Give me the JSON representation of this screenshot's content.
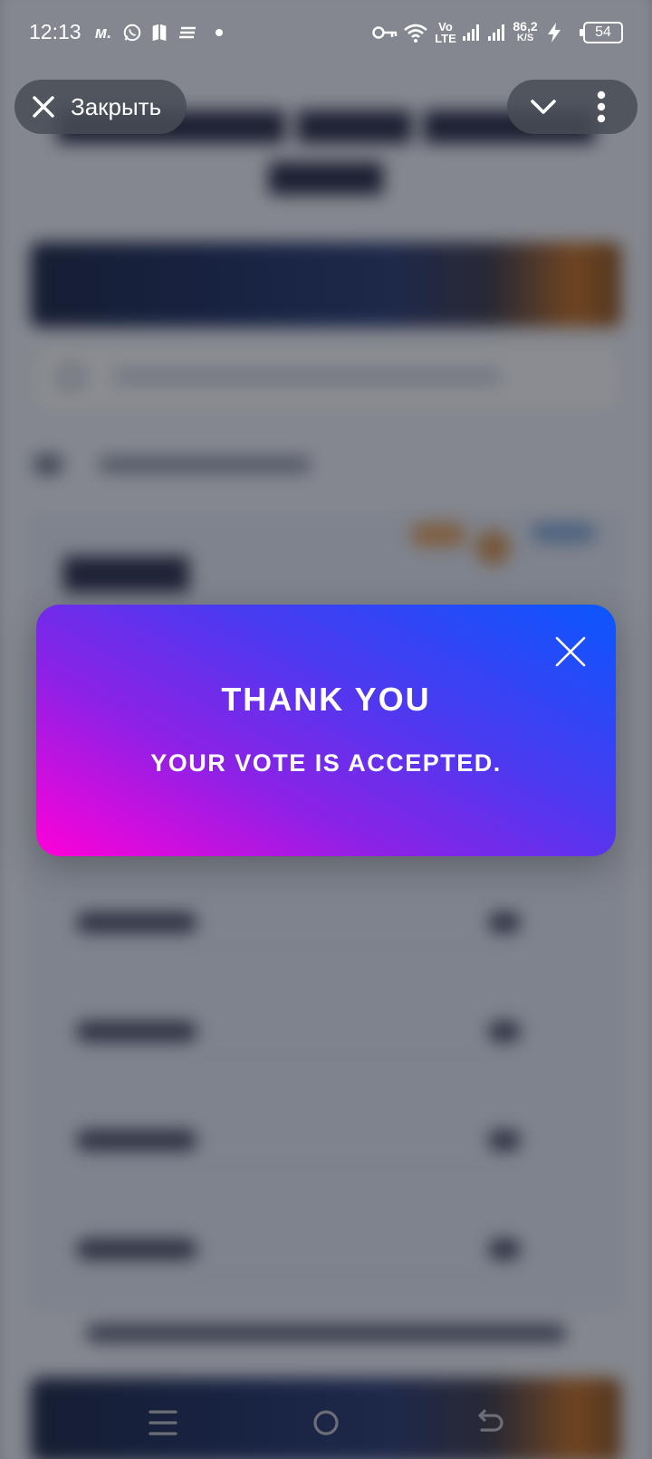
{
  "status_bar": {
    "time": "12:13",
    "network_speed_value": "86,2",
    "network_speed_unit": "K/S",
    "volte_top": "Vo",
    "volte_bottom": "LTE",
    "battery": "54"
  },
  "top_bar": {
    "close_label": "Закрыть"
  },
  "modal": {
    "title": "THANK YOU",
    "message": "YOUR VOTE IS ACCEPTED."
  },
  "colors": {
    "modal_gradient_start": "#0a57fe",
    "modal_gradient_end": "#ff00d8"
  }
}
